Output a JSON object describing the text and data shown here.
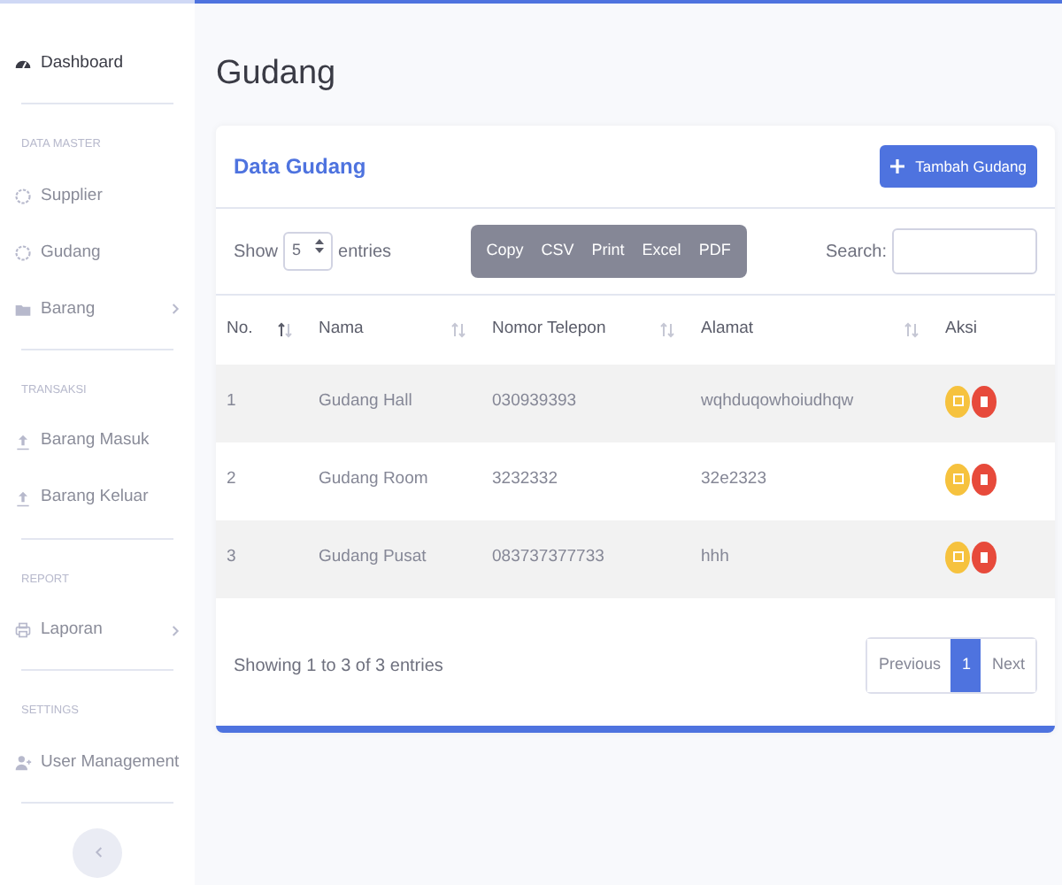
{
  "sidebar": {
    "items": [
      {
        "kind": "item",
        "label": "Dashboard",
        "submenu": false,
        "active": true
      },
      {
        "kind": "divider"
      },
      {
        "kind": "heading",
        "label": "DATA MASTER"
      },
      {
        "kind": "item",
        "label": "Supplier",
        "submenu": false,
        "active": false
      },
      {
        "kind": "item",
        "label": "Gudang",
        "submenu": false,
        "active": false
      },
      {
        "kind": "item",
        "label": "Barang",
        "submenu": true,
        "active": false
      },
      {
        "kind": "divider"
      },
      {
        "kind": "heading",
        "label": "TRANSAKSI"
      },
      {
        "kind": "item",
        "label": "Barang Masuk",
        "submenu": false,
        "active": false
      },
      {
        "kind": "item",
        "label": "Barang Keluar",
        "submenu": false,
        "active": false
      },
      {
        "kind": "divider"
      },
      {
        "kind": "heading",
        "label": "REPORT"
      },
      {
        "kind": "item",
        "label": "Laporan",
        "submenu": true,
        "active": false
      },
      {
        "kind": "divider"
      },
      {
        "kind": "heading",
        "label": "SETTINGS"
      },
      {
        "kind": "item",
        "label": "User Management",
        "submenu": false,
        "active": false
      },
      {
        "kind": "divider"
      }
    ]
  },
  "page_title": "Gudang",
  "card": {
    "title": "Data Gudang",
    "add_button": "Tambah Gudang",
    "length": {
      "before": "Show",
      "value": "5",
      "after": "entries"
    },
    "export_buttons": [
      "Copy",
      "CSV",
      "Print",
      "Excel",
      "PDF"
    ],
    "search_label": "Search:",
    "table": {
      "columns": [
        {
          "label": "No.",
          "sorted": true
        },
        {
          "label": "Nama",
          "sorted": false
        },
        {
          "label": "Nomor Telepon",
          "sorted": false
        },
        {
          "label": "Alamat",
          "sorted": false
        },
        {
          "label": "Aksi"
        }
      ],
      "rows": [
        [
          "1",
          "Gudang Hall",
          "030939393",
          "wqhduqowhoiudhqw"
        ],
        [
          "2",
          "Gudang Room",
          "3232332",
          "32e2323"
        ],
        [
          "3",
          "Gudang Pusat",
          "083737377733",
          "hhh"
        ]
      ]
    },
    "info": "Showing 1 to 3 of 3 entries",
    "pagination": [
      {
        "label": "Previous",
        "selected": false
      },
      {
        "label": "1",
        "selected": true
      },
      {
        "label": "Next",
        "selected": false
      }
    ]
  }
}
